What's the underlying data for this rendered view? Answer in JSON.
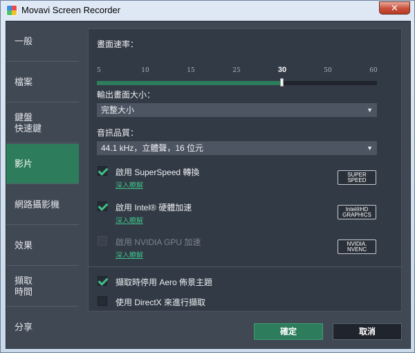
{
  "window": {
    "title": "Movavi Screen Recorder",
    "close_label": "✕"
  },
  "sidebar": {
    "items": [
      {
        "label": "一般"
      },
      {
        "label": "檔案"
      },
      {
        "label": "鍵盤\n快速鍵"
      },
      {
        "label": "影片",
        "active": true
      },
      {
        "label": "網路攝影機"
      },
      {
        "label": "效果"
      },
      {
        "label": "擷取\n時間"
      },
      {
        "label": "分享"
      }
    ]
  },
  "video": {
    "fps_label": "畫面速率：",
    "fps_ticks": [
      "5",
      "10",
      "15",
      "25",
      "30",
      "50",
      "60"
    ],
    "fps_selected": "30",
    "fps_fraction": 0.66,
    "frame_size_label": "輸出畫面大小：",
    "frame_size_value": "完整大小",
    "audio_quality_label": "音訊品質：",
    "audio_quality_value": "44.1 kHz，立體聲，16 位元",
    "superspeed_label": "啟用 SuperSpeed 轉換",
    "superspeed_link": "深入瞭解",
    "superspeed_badge": "SUPER\nSPEED",
    "superspeed_checked": true,
    "intel_label": "啟用 Intel® 硬體加速",
    "intel_link": "深入瞭解",
    "intel_badge": "Intel®HD\nGRAPHICS",
    "intel_checked": true,
    "nvidia_label": "啟用 NVIDIA GPU 加速",
    "nvidia_link": "深入瞭解",
    "nvidia_badge": "NVIDIA.\nNVENC",
    "nvidia_checked": false,
    "aero_label": "擷取時停用 Aero 佈景主題",
    "aero_checked": true,
    "directx_label": "使用 DirectX 來進行擷取",
    "directx_checked": false
  },
  "buttons": {
    "ok": "確定",
    "cancel": "取消"
  },
  "colors": {
    "accent": "#2d7d5c",
    "panel": "#323a45",
    "background": "#404854"
  }
}
